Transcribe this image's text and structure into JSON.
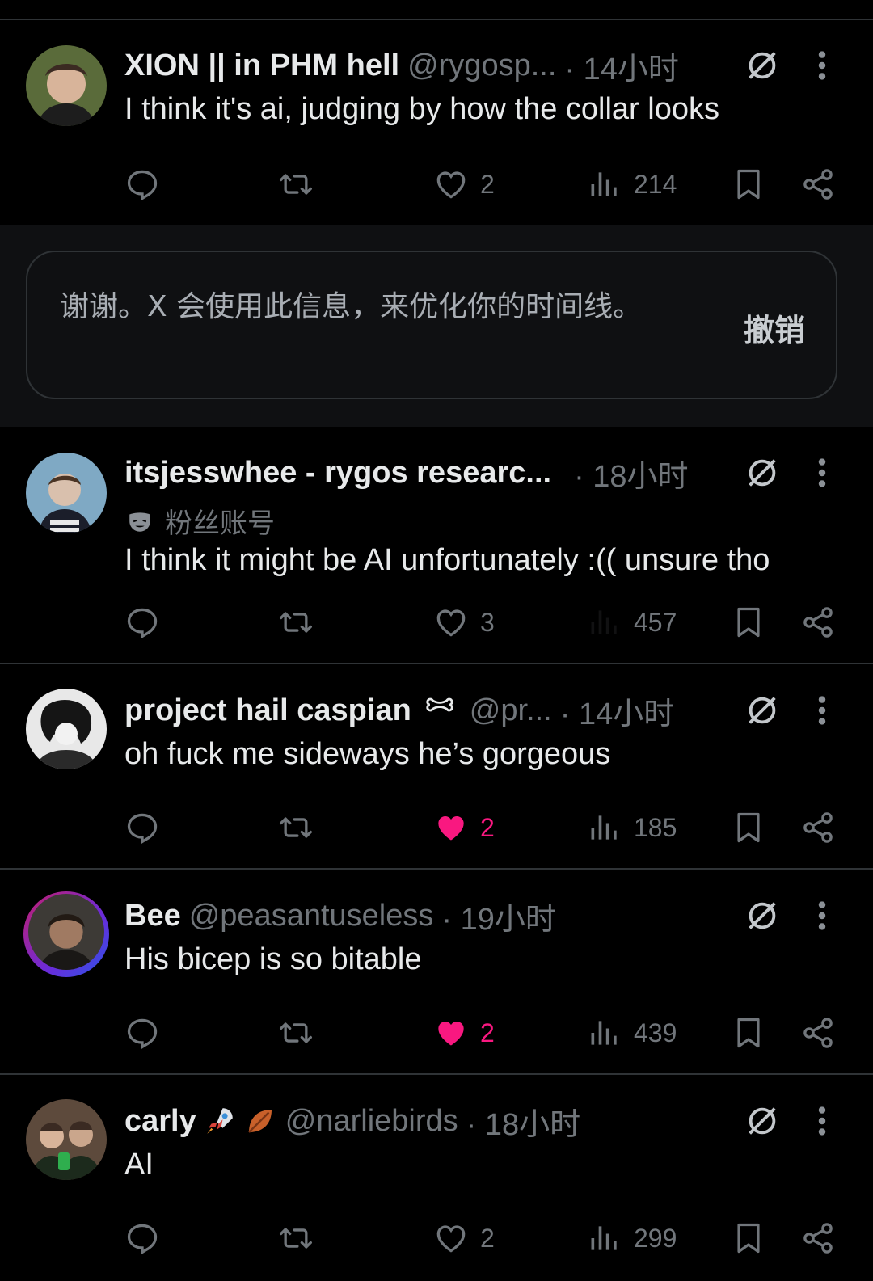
{
  "posts": [
    {
      "name": "XION || in PHM hell",
      "handle": "@rygosp...",
      "time": "· 14小时",
      "text": "I think it's ai, judging by how the collar looks",
      "likes": "2",
      "views": "214",
      "liked": false
    },
    {
      "name": "itsjesswhee - rygos researc...",
      "handle": "",
      "time": "· 18小时",
      "badge": "粉丝账号",
      "text": "I think it might be AI unfortunately :(( unsure tho",
      "likes": "3",
      "views": "457",
      "liked": false
    },
    {
      "name": "project hail caspian",
      "handle": "@pr...",
      "time": "· 14小时",
      "text": "oh fuck me sideways he’s gorgeous",
      "likes": "2",
      "views": "185",
      "liked": true
    },
    {
      "name": "Bee",
      "handle": "@peasantuseless",
      "time": "· 19小时",
      "text": "His bicep is so bitable",
      "likes": "2",
      "views": "439",
      "liked": true
    },
    {
      "name": "carly",
      "handle": "@narliebirds",
      "time": "· 18小时",
      "text": "AI",
      "likes": "2",
      "views": "299",
      "liked": false
    }
  ],
  "notice": {
    "message": "谢谢。X 会使用此信息，来优化你的时间线。",
    "undo_label": "撤销"
  },
  "colors": {
    "background": "#000000",
    "like_active": "#f91880",
    "muted": "#71767b"
  }
}
